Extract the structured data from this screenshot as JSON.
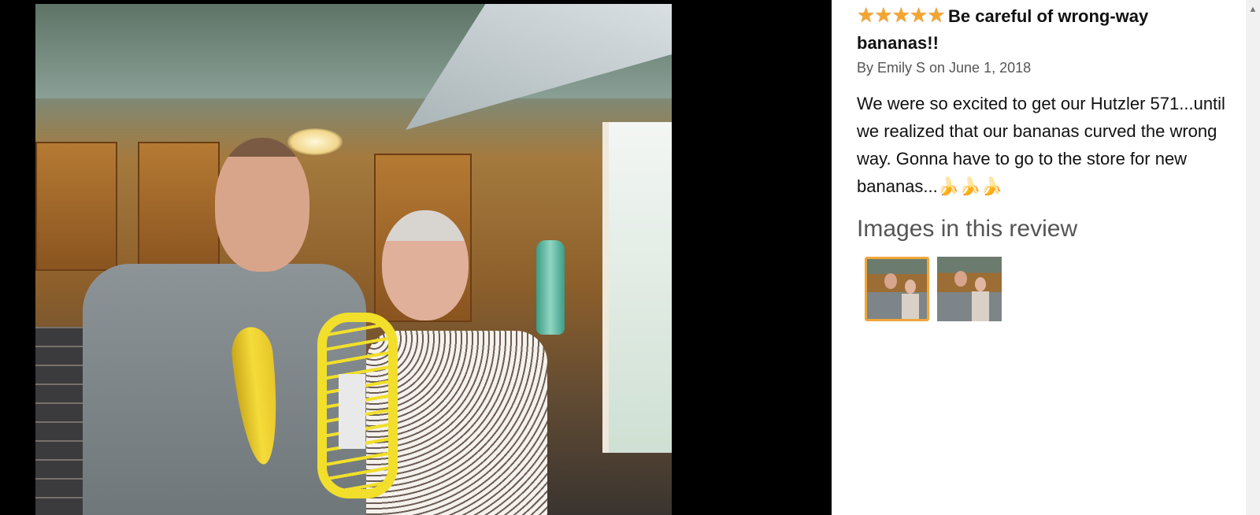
{
  "review": {
    "rating_icon": "five-stars-icon",
    "stars": "★★★★★",
    "title": "Be careful of wrong-way bananas!!",
    "byline": "By Emily S on June 1, 2018",
    "body": "We were so excited to get our Hutzler 571...until we realized that our bananas curved the wrong way. Gonna have to go to the store for new bananas...",
    "body_emoji": "🍌🍌🍌",
    "images_heading": "Images in this review",
    "thumbnails": [
      {
        "name": "thumbnail-1",
        "selected": true
      },
      {
        "name": "thumbnail-2",
        "selected": false
      }
    ]
  },
  "colors": {
    "star": "#f3a531",
    "selected_thumb_border": "#f0a63a",
    "viewer_bg": "#000000"
  }
}
